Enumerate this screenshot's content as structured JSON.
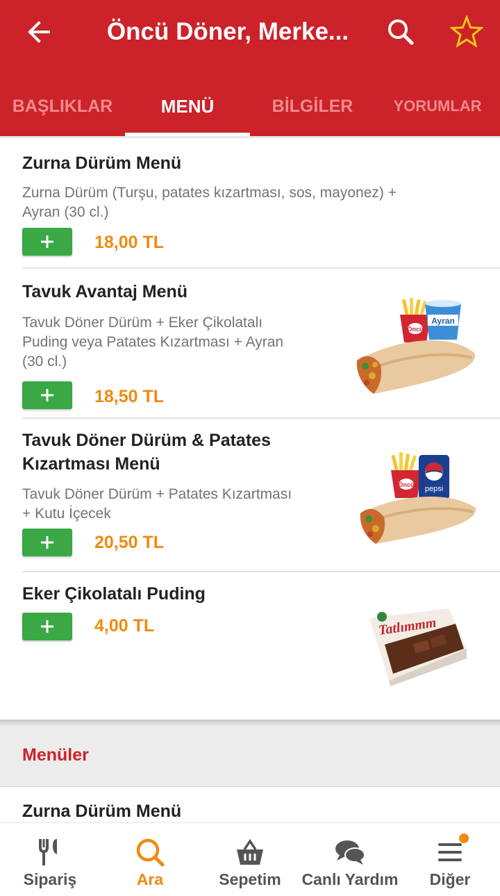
{
  "header": {
    "title": "Öncü Döner, Merke..."
  },
  "tabs": [
    {
      "label": "BAŞLIKLAR",
      "active": false
    },
    {
      "label": "MENÜ",
      "active": true
    },
    {
      "label": "BİLGİLER",
      "active": false
    },
    {
      "label": "YORUMLAR",
      "active": false
    }
  ],
  "items": [
    {
      "name": "Zurna Dürüm Menü",
      "description": [
        "Zurna Dürüm (Turşu, patates kızartması, sos, mayonez) +",
        "Ayran (30 cl.)"
      ],
      "price": "18,00 TL"
    },
    {
      "name": "Tavuk Avantaj Menü",
      "description": [
        "Tavuk Döner Dürüm + Eker Çikolatalı",
        "Puding veya Patates Kızartması + Ayran",
        "(30 cl.)"
      ],
      "price": "18,50 TL",
      "image": {
        "fries_box_text": "Öncü",
        "cup_text": "Ayran"
      }
    },
    {
      "name": [
        "Tavuk Döner Dürüm & Patates",
        "Kızartması Menü"
      ],
      "description": [
        "Tavuk Döner Dürüm + Patates Kızartması",
        "+ Kutu İçecek"
      ],
      "price": "20,50 TL",
      "image": {
        "fries_box_text": "Öncü",
        "can_text": "pepsi"
      }
    },
    {
      "name": "Eker Çikolatalı Puding",
      "price": "4,00 TL",
      "image": {
        "brand_text": "Tatlımmm"
      }
    }
  ],
  "section": {
    "title": "Menüler",
    "first_item": "Zurna Dürüm Menü"
  },
  "bottom_nav": [
    {
      "label": "Sipariş",
      "icon": "fork-knife-icon",
      "active": false
    },
    {
      "label": "Ara",
      "icon": "search-icon",
      "active": true
    },
    {
      "label": "Sepetim",
      "icon": "basket-icon",
      "active": false
    },
    {
      "label": "Canlı Yardım",
      "icon": "chat-bubbles-icon",
      "active": false
    },
    {
      "label": "Diğer",
      "icon": "menu-icon",
      "active": false,
      "has_notification": true
    }
  ],
  "colors": {
    "brand_red": "#cc2229",
    "price_orange": "#f08a0f",
    "add_green": "#3aa845",
    "star_yellow": "#f5c518"
  },
  "icons": {
    "add": "plus-icon",
    "back": "arrow-left-icon",
    "search": "search-icon",
    "favorite": "star-outline-icon"
  }
}
